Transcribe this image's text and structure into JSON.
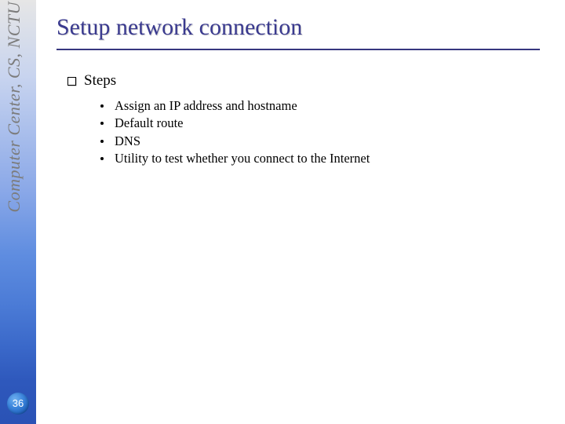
{
  "sidebar": {
    "org_label": "Computer Center, CS, NCTU",
    "page_number": "36"
  },
  "slide": {
    "title": "Setup network connection",
    "section_heading": "Steps",
    "bullets": [
      "Assign an IP address and hostname",
      "Default route",
      "DNS",
      "Utility to test whether you connect to the Internet"
    ]
  }
}
